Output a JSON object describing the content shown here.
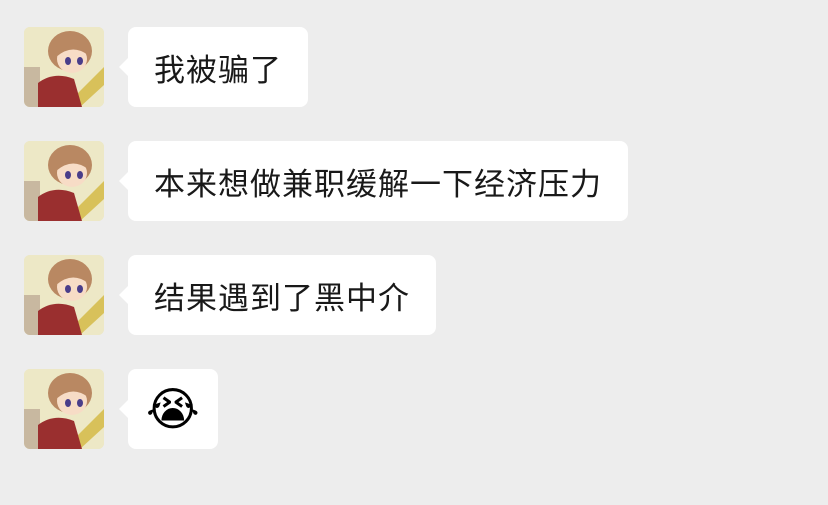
{
  "messages": [
    {
      "sender": "other",
      "avatar_icon": "anime-girl-avatar",
      "type": "text",
      "text": "我被骗了"
    },
    {
      "sender": "other",
      "avatar_icon": "anime-girl-avatar",
      "type": "text",
      "text": "本来想做兼职缓解一下经济压力"
    },
    {
      "sender": "other",
      "avatar_icon": "anime-girl-avatar",
      "type": "text",
      "text": "结果遇到了黑中介"
    },
    {
      "sender": "other",
      "avatar_icon": "anime-girl-avatar",
      "type": "emoji",
      "text": "😭",
      "emoji_name": "loudly-crying-face"
    }
  ],
  "colors": {
    "background": "#ededed",
    "bubble": "#ffffff",
    "text": "#191919"
  }
}
